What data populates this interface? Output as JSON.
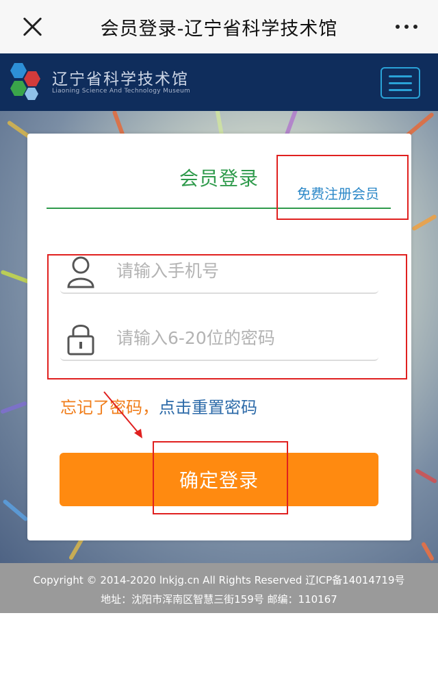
{
  "titlebar": {
    "title": "会员登录-辽宁省科学技术馆",
    "close_icon": "close-icon",
    "more_icon": "more-icon"
  },
  "header": {
    "name": "辽宁省科学技术馆",
    "subtitle": "Liaoning Science And Technology Museum",
    "logo": "hexagon-logo",
    "menu_icon": "hamburger-icon"
  },
  "login": {
    "tab_label": "会员登录",
    "register_link": "免费注册会员",
    "phone_placeholder": "请输入手机号",
    "phone_icon": "user-icon",
    "password_placeholder": "请输入6-20位的密码",
    "password_icon": "lock-icon",
    "forgot_prefix": "忘记了密码，",
    "forgot_link": "点击重置密码",
    "submit_label": "确定登录"
  },
  "footer": {
    "line1": "Copyright © 2014-2020 lnkjg.cn All Rights Reserved    辽ICP备14014719号",
    "line2": "地址：沈阳市浑南区智慧三街159号      邮编：110167"
  },
  "colors": {
    "header_bg": "#0f2d5c",
    "accent_green": "#2e9a4b",
    "link_blue": "#2c88c8",
    "button_orange": "#ff8a10",
    "annotation_red": "#e0201f"
  }
}
